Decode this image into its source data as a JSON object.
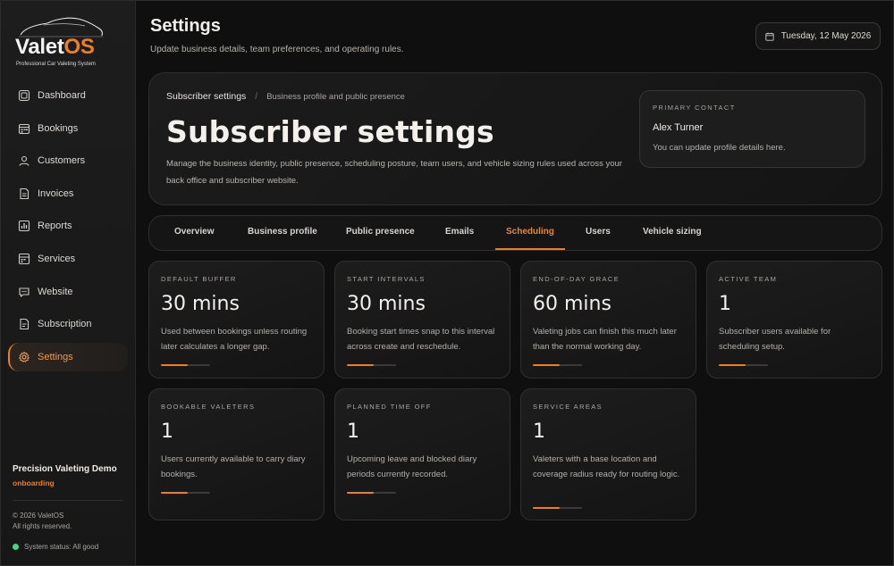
{
  "brand": {
    "name_part1": "Valet",
    "name_part2": "OS",
    "tagline": "Professional Car Valeting System"
  },
  "sidebar": {
    "items": [
      {
        "label": "Dashboard",
        "icon": "dashboard-icon",
        "active": false
      },
      {
        "label": "Bookings",
        "icon": "calendar-icon",
        "active": false
      },
      {
        "label": "Customers",
        "icon": "customers-icon",
        "active": false
      },
      {
        "label": "Invoices",
        "icon": "invoice-icon",
        "active": false
      },
      {
        "label": "Reports",
        "icon": "reports-icon",
        "active": false
      },
      {
        "label": "Services",
        "icon": "services-icon",
        "active": false
      },
      {
        "label": "Website",
        "icon": "website-icon",
        "active": false
      },
      {
        "label": "Subscription",
        "icon": "subscription-icon",
        "active": false
      },
      {
        "label": "Settings",
        "icon": "gear-icon",
        "active": true
      }
    ],
    "business_name": "Precision Valeting Demo",
    "business_status": "onboarding",
    "copyright": "© 2026 ValetOS",
    "rights": "All rights reserved.",
    "system_status": "System status: All good",
    "status_color": "#3ddc84"
  },
  "header": {
    "title": "Settings",
    "subtitle": "Update business details, team preferences, and operating rules.",
    "date": "Tuesday, 12 May 2026"
  },
  "hero": {
    "breadcrumb_current": "Subscriber settings",
    "breadcrumb_context": "Business profile and public presence",
    "title": "Subscriber settings",
    "description": "Manage the business identity, public presence, scheduling posture, team users, and vehicle sizing rules used across your back office and subscriber website.",
    "contact": {
      "label": "PRIMARY CONTACT",
      "name": "Alex Turner",
      "note": "You can update profile details here."
    }
  },
  "tabs": [
    {
      "label": "Overview",
      "active": false
    },
    {
      "label": "Business profile",
      "active": false
    },
    {
      "label": "Public presence",
      "active": false
    },
    {
      "label": "Emails",
      "active": false
    },
    {
      "label": "Scheduling",
      "active": true
    },
    {
      "label": "Users",
      "active": false
    },
    {
      "label": "Vehicle sizing",
      "active": false
    }
  ],
  "cards": [
    {
      "label": "DEFAULT BUFFER",
      "value": "30 mins",
      "description": "Used between bookings unless routing later calculates a longer gap.",
      "progress": 0.55
    },
    {
      "label": "START INTERVALS",
      "value": "30 mins",
      "description": "Booking start times snap to this interval across create and reschedule.",
      "progress": 0.55
    },
    {
      "label": "END-OF-DAY GRACE",
      "value": "60 mins",
      "description": "Valeting jobs can finish this much later than the normal working day.",
      "progress": 0.55
    },
    {
      "label": "ACTIVE TEAM",
      "value": "1",
      "description": "Subscriber users available for scheduling setup.",
      "progress": 0.55
    },
    {
      "label": "BOOKABLE VALETERS",
      "value": "1",
      "description": "Users currently available to carry diary bookings.",
      "progress": 0.55
    },
    {
      "label": "PLANNED TIME OFF",
      "value": "1",
      "description": "Upcoming leave and blocked diary periods currently recorded.",
      "progress": 0.55
    },
    {
      "label": "SERVICE AREAS",
      "value": "1",
      "description": "Valeters with a base location and coverage radius ready for routing logic.",
      "progress": 0.55
    }
  ],
  "colors": {
    "accent": "#ef7d22",
    "background": "#0f0f0f",
    "panel": "#1b1b1b"
  }
}
